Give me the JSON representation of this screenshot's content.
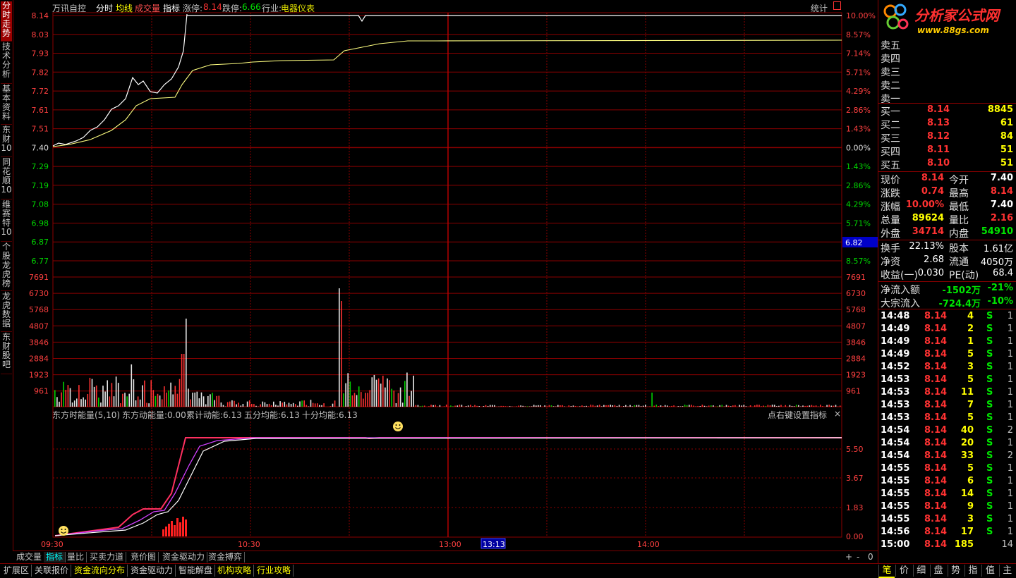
{
  "header": {
    "stock_name": "万讯自控",
    "mode_tabs": [
      "分时",
      "均线",
      "成交量",
      "指标"
    ],
    "limit_up_label": "涨停:",
    "limit_up_value": "8.14",
    "limit_down_label": "跌停:",
    "limit_down_value": "6.66",
    "industry_label": "行业:",
    "industry_value": "电器仪表",
    "stats_button": "统计"
  },
  "left_tabs": [
    "分时走势",
    "技术分析",
    "基本资料",
    "东财10",
    "同花顺10",
    "维赛特10",
    "个股龙虎榜",
    "龙虎数据",
    "东财股吧"
  ],
  "logo": {
    "title": "分析家公式网",
    "url": "www.88gs.com"
  },
  "price_axis": {
    "left": [
      "8.14",
      "8.03",
      "7.93",
      "7.82",
      "7.72",
      "7.61",
      "7.51",
      "7.40",
      "7.29",
      "7.19",
      "7.08",
      "6.98",
      "6.87",
      "6.77"
    ],
    "right": [
      "10.00%",
      "8.57%",
      "7.14%",
      "5.71%",
      "4.29%",
      "2.86%",
      "1.43%",
      "0.00%",
      "1.43%",
      "2.86%",
      "4.29%",
      "5.71%",
      "7.14%",
      "8.57%"
    ],
    "cursor_value": "6.82"
  },
  "volume_axis": [
    "7691",
    "6730",
    "5768",
    "4807",
    "3846",
    "2884",
    "1923",
    "961"
  ],
  "indicator": {
    "title": "东方时能量(5,10)",
    "items": [
      "东方动能量:0.00",
      "累计动能:6.13",
      "五分均能:6.13",
      "十分均能:6.13"
    ],
    "settings_hint": "点右键设置指标",
    "axis": [
      "5.50",
      "3.67",
      "1.83",
      "0.00"
    ]
  },
  "time_axis": [
    "09:30",
    "10:30",
    "13:00",
    "13:13",
    "14:00"
  ],
  "order_book": {
    "sell": [
      {
        "label": "卖五",
        "price": "",
        "vol": ""
      },
      {
        "label": "卖四",
        "price": "",
        "vol": ""
      },
      {
        "label": "卖三",
        "price": "",
        "vol": ""
      },
      {
        "label": "卖二",
        "price": "",
        "vol": ""
      },
      {
        "label": "卖一",
        "price": "",
        "vol": ""
      }
    ],
    "buy": [
      {
        "label": "买一",
        "price": "8.14",
        "vol": "8845"
      },
      {
        "label": "买二",
        "price": "8.13",
        "vol": "61"
      },
      {
        "label": "买三",
        "price": "8.12",
        "vol": "84"
      },
      {
        "label": "买四",
        "price": "8.11",
        "vol": "51"
      },
      {
        "label": "买五",
        "price": "8.10",
        "vol": "51"
      }
    ]
  },
  "quote": [
    {
      "l1": "现价",
      "v1": "8.14",
      "l2": "今开",
      "v2": "7.40"
    },
    {
      "l1": "涨跌",
      "v1": "0.74",
      "l2": "最高",
      "v2": "8.14"
    },
    {
      "l1": "涨幅",
      "v1": "10.00%",
      "l2": "最低",
      "v2": "7.40"
    },
    {
      "l1": "总量",
      "v1": "89624",
      "l2": "量比",
      "v2": "2.16"
    },
    {
      "l1": "外盘",
      "v1": "34714",
      "l2": "内盘",
      "v2": "54910"
    }
  ],
  "fundamentals": [
    {
      "l1": "换手",
      "v1": "22.13%",
      "l2": "股本",
      "v2": "1.61亿"
    },
    {
      "l1": "净资",
      "v1": "2.68",
      "l2": "流通",
      "v2": "4050万"
    },
    {
      "l1": "收益(一)",
      "v1": "0.030",
      "l2": "PE(动)",
      "v2": "68.4"
    }
  ],
  "flow": [
    {
      "label": "净流入额",
      "value": "-1502万",
      "pct": "-21%"
    },
    {
      "label": "大宗流入",
      "value": "-724.4万",
      "pct": "-10%"
    }
  ],
  "ticks": [
    {
      "time": "14:48",
      "price": "8.14",
      "vol": "4",
      "side": "S",
      "n": "1"
    },
    {
      "time": "14:49",
      "price": "8.14",
      "vol": "2",
      "side": "S",
      "n": "1"
    },
    {
      "time": "14:49",
      "price": "8.14",
      "vol": "1",
      "side": "S",
      "n": "1"
    },
    {
      "time": "14:49",
      "price": "8.14",
      "vol": "5",
      "side": "S",
      "n": "1"
    },
    {
      "time": "14:52",
      "price": "8.14",
      "vol": "3",
      "side": "S",
      "n": "1"
    },
    {
      "time": "14:53",
      "price": "8.14",
      "vol": "5",
      "side": "S",
      "n": "1"
    },
    {
      "time": "14:53",
      "price": "8.14",
      "vol": "11",
      "side": "S",
      "n": "1"
    },
    {
      "time": "14:53",
      "price": "8.14",
      "vol": "7",
      "side": "S",
      "n": "1"
    },
    {
      "time": "14:53",
      "price": "8.14",
      "vol": "5",
      "side": "S",
      "n": "1"
    },
    {
      "time": "14:54",
      "price": "8.14",
      "vol": "40",
      "side": "S",
      "n": "2"
    },
    {
      "time": "14:54",
      "price": "8.14",
      "vol": "20",
      "side": "S",
      "n": "1"
    },
    {
      "time": "14:54",
      "price": "8.14",
      "vol": "33",
      "side": "S",
      "n": "2"
    },
    {
      "time": "14:55",
      "price": "8.14",
      "vol": "5",
      "side": "S",
      "n": "1"
    },
    {
      "time": "14:55",
      "price": "8.14",
      "vol": "6",
      "side": "S",
      "n": "1"
    },
    {
      "time": "14:55",
      "price": "8.14",
      "vol": "14",
      "side": "S",
      "n": "1"
    },
    {
      "time": "14:55",
      "price": "8.14",
      "vol": "9",
      "side": "S",
      "n": "1"
    },
    {
      "time": "14:55",
      "price": "8.14",
      "vol": "3",
      "side": "S",
      "n": "1"
    },
    {
      "time": "14:56",
      "price": "8.14",
      "vol": "17",
      "side": "S",
      "n": "1"
    },
    {
      "time": "15:00",
      "price": "8.14",
      "vol": "185",
      "side": "",
      "n": "14"
    }
  ],
  "bottom_tabs": [
    "成交量",
    "指标",
    "量比",
    "买卖力道",
    "竞价图",
    "资金驱动力",
    "资金搏弈"
  ],
  "bottom_tab_active": 1,
  "status_tabs": [
    "扩展区",
    "关联报价",
    "资金流向分布",
    "资金驱动力",
    "智能解盘",
    "机构攻略",
    "行业攻略"
  ],
  "right_buttons": [
    "笔",
    "价",
    "细",
    "盘",
    "势",
    "指",
    "值",
    "主"
  ],
  "zoom_buttons": [
    "+",
    "-",
    "0"
  ],
  "colors": {
    "up": "#ff3232",
    "down": "#00e600",
    "grid": "#8b0000",
    "price_line": "#ffffff",
    "avg_line": "#ffff80"
  }
}
